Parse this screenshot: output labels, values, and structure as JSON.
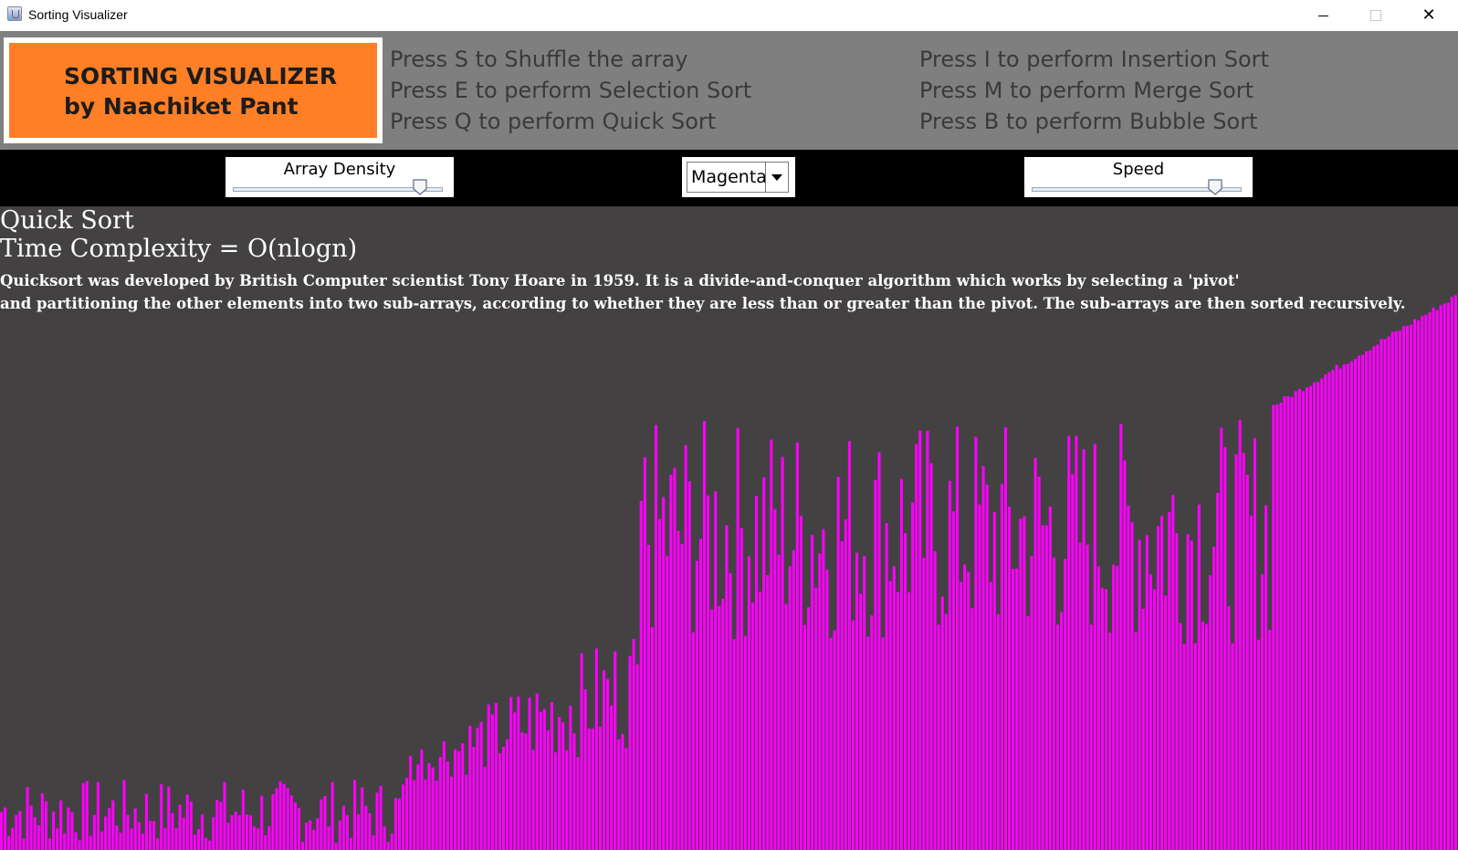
{
  "window": {
    "title": "Sorting Visualizer",
    "icon": "java-cup-icon",
    "controls": [
      "minimize",
      "maximize",
      "close"
    ]
  },
  "header": {
    "logo_line1": "SORTING VISUALIZER",
    "logo_line2": "by Naachiket Pant",
    "logo_color": "#ff7f27",
    "instructions_left": [
      "Press S to Shuffle the array",
      "Press E to perform Selection Sort",
      "Press Q to perform Quick Sort"
    ],
    "instructions_right": [
      "Press I to perform Insertion Sort",
      "Press M to perform Merge Sort",
      "Press B to perform Bubble Sort"
    ]
  },
  "controls": {
    "density_label": "Array Density",
    "density_level": 0.92,
    "color_value": "Magenta",
    "speed_label": "Speed",
    "speed_level": 0.9
  },
  "info": {
    "algorithm": "Quick Sort",
    "complexity": "Time Complexity = O(nlogn)",
    "desc_line1": "Quicksort was developed by British Computer scientist Tony Hoare in 1959. It is a divide-and-conquer algorithm which works by selecting a 'pivot'",
    "desc_line2": "and partitioning the other elements into two sub-arrays, according to whether they are less than or greater than the pivot. The sub-arrays are then sorted recursively."
  },
  "bars": {
    "color": "#ff00ff",
    "background": "#444143",
    "count": 392,
    "segments": [
      {
        "from": 0,
        "to": 108,
        "min": 0.01,
        "max": 0.11,
        "mode": "noise"
      },
      {
        "from": 108,
        "to": 174,
        "min": 0.1,
        "max": 0.19,
        "mode": "ramp"
      },
      {
        "from": 174,
        "to": 171,
        "min": 0.13,
        "max": 0.31,
        "mode": "noise"
      },
      {
        "from": 171,
        "to": 342,
        "min": 0.32,
        "max": 0.67,
        "mode": "noise"
      },
      {
        "from": 342,
        "to": 392,
        "min": 0.69,
        "max": 0.86,
        "mode": "ramp"
      }
    ]
  }
}
